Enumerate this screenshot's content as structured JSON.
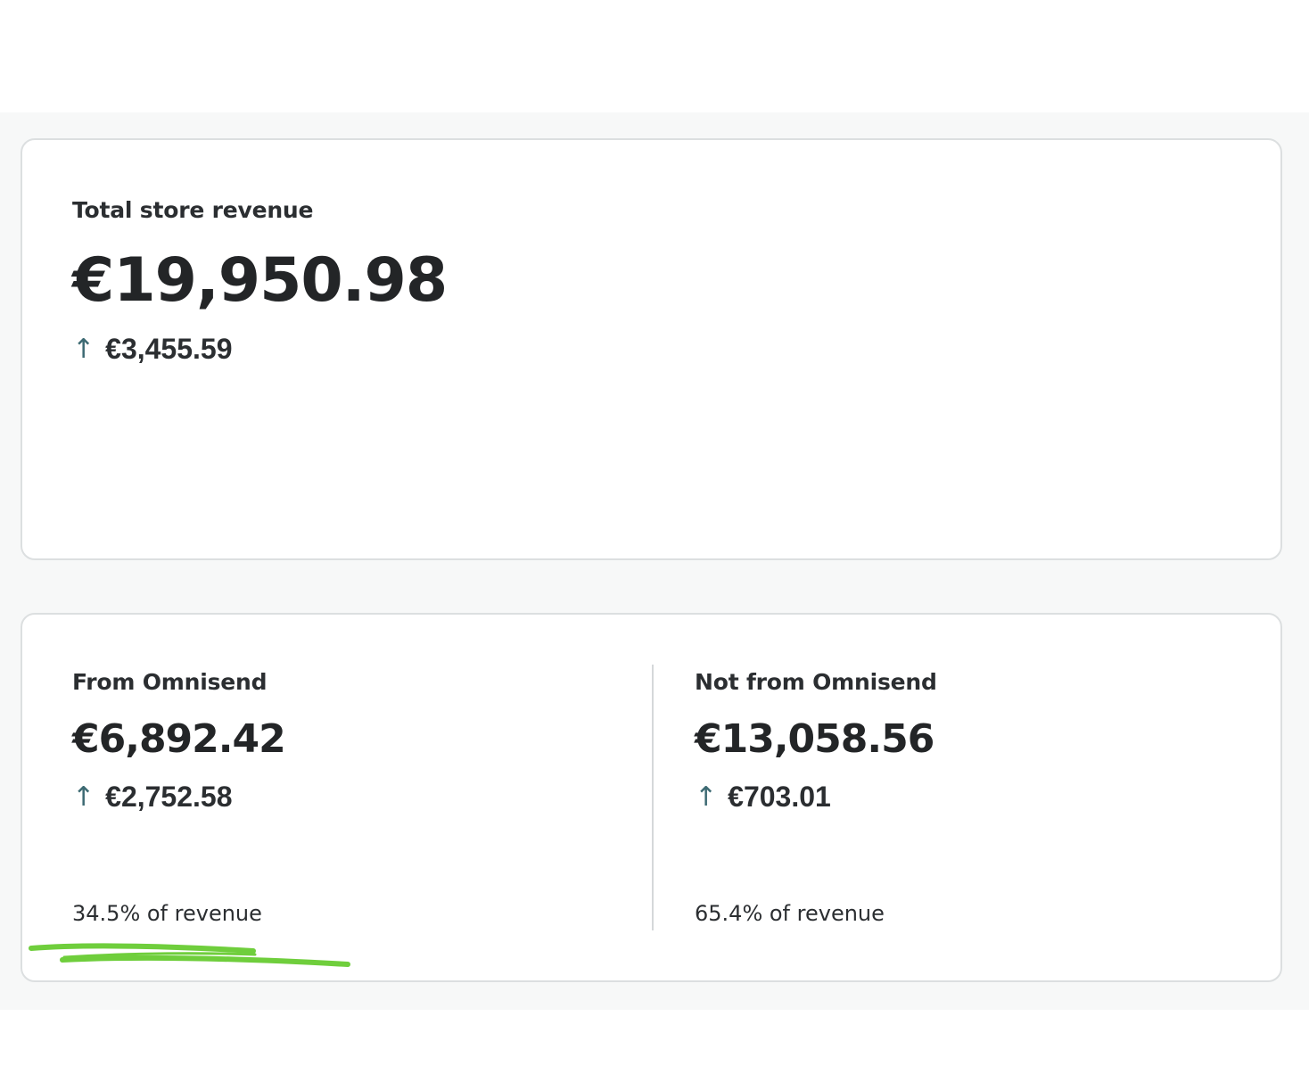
{
  "total": {
    "label": "Total store revenue",
    "value": "€19,950.98",
    "change": "€3,455.59"
  },
  "breakdown": {
    "omnisend": {
      "label": "From Omnisend",
      "value": "€6,892.42",
      "change": "€2,752.58",
      "share": "34.5% of revenue"
    },
    "not_omnisend": {
      "label": "Not from Omnisend",
      "value": "€13,058.56",
      "change": "€703.01",
      "share": "65.4% of revenue"
    }
  },
  "colors": {
    "arrow": "#3d6a73",
    "highlight": "#6fce3c"
  },
  "icons": {
    "trend": "arrow-up-icon"
  }
}
